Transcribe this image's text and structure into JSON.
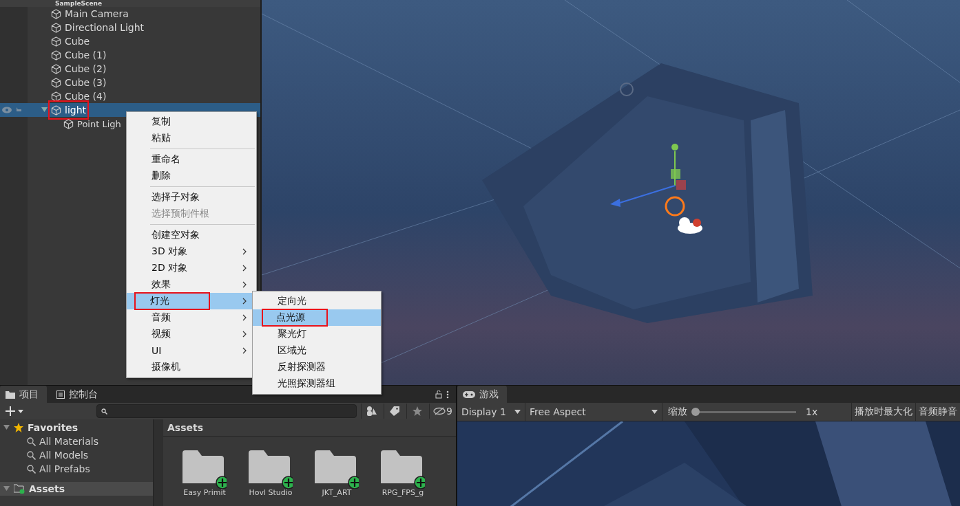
{
  "hierarchy": {
    "scene": "SampleScene",
    "items": [
      {
        "name": "Main Camera",
        "selected": false,
        "annotated": false
      },
      {
        "name": "Directional Light",
        "selected": false,
        "annotated": false
      },
      {
        "name": "Cube",
        "selected": false,
        "annotated": false
      },
      {
        "name": "Cube (1)",
        "selected": false,
        "annotated": false
      },
      {
        "name": "Cube (2)",
        "selected": false,
        "annotated": false
      },
      {
        "name": "Cube (3)",
        "selected": false,
        "annotated": false
      },
      {
        "name": "Cube (4)",
        "selected": false,
        "annotated": false
      },
      {
        "name": "light",
        "selected": true,
        "annotated": true,
        "expanded": true,
        "children": [
          {
            "name": "Point Ligh",
            "selected": false,
            "annotated": false
          }
        ]
      }
    ]
  },
  "context_menu": {
    "groups": [
      [
        {
          "label": "复制",
          "disabled": false,
          "submenu": false,
          "selected": false,
          "annotated": false
        },
        {
          "label": "粘贴",
          "disabled": false,
          "submenu": false,
          "selected": false,
          "annotated": false
        }
      ],
      [
        {
          "label": "重命名",
          "disabled": false,
          "submenu": false,
          "selected": false,
          "annotated": false
        },
        {
          "label": "删除",
          "disabled": false,
          "submenu": false,
          "selected": false,
          "annotated": false
        }
      ],
      [
        {
          "label": "选择子对象",
          "disabled": false,
          "submenu": false,
          "selected": false,
          "annotated": false
        },
        {
          "label": "选择预制件根",
          "disabled": true,
          "submenu": false,
          "selected": false,
          "annotated": false
        }
      ],
      [
        {
          "label": "创建空对象",
          "disabled": false,
          "submenu": false,
          "selected": false,
          "annotated": false
        },
        {
          "label": "3D 对象",
          "disabled": false,
          "submenu": true,
          "selected": false,
          "annotated": false
        },
        {
          "label": "2D 对象",
          "disabled": false,
          "submenu": true,
          "selected": false,
          "annotated": false
        },
        {
          "label": "效果",
          "disabled": false,
          "submenu": true,
          "selected": false,
          "annotated": false
        },
        {
          "label": "灯光",
          "disabled": false,
          "submenu": true,
          "selected": true,
          "annotated": true
        },
        {
          "label": "音频",
          "disabled": false,
          "submenu": true,
          "selected": false,
          "annotated": false
        },
        {
          "label": "视频",
          "disabled": false,
          "submenu": true,
          "selected": false,
          "annotated": false
        },
        {
          "label": "UI",
          "disabled": false,
          "submenu": true,
          "selected": false,
          "annotated": false
        },
        {
          "label": "摄像机",
          "disabled": false,
          "submenu": false,
          "selected": false,
          "annotated": false
        }
      ]
    ]
  },
  "submenu": {
    "items": [
      {
        "label": "定向光",
        "selected": false,
        "annotated": false
      },
      {
        "label": "点光源",
        "selected": true,
        "annotated": true
      },
      {
        "label": "聚光灯",
        "selected": false,
        "annotated": false
      },
      {
        "label": "区域光",
        "selected": false,
        "annotated": false
      },
      {
        "label": "反射探测器",
        "selected": false,
        "annotated": false
      },
      {
        "label": "光照探测器组",
        "selected": false,
        "annotated": false
      }
    ]
  },
  "project": {
    "tabs": [
      {
        "label": "项目",
        "selected": true,
        "kind": "folder"
      },
      {
        "label": "控制台",
        "selected": false,
        "kind": "console"
      }
    ],
    "hidden_count": "9",
    "tree": [
      {
        "label": "Favorites",
        "kind": "favorites",
        "expanded": true,
        "selected": false,
        "children": [
          {
            "label": "All Materials",
            "kind": "search"
          },
          {
            "label": "All Models",
            "kind": "search"
          },
          {
            "label": "All Prefabs",
            "kind": "search"
          }
        ]
      },
      {
        "label": "Assets",
        "kind": "assets",
        "expanded": true,
        "selected": true
      }
    ],
    "breadcrumb": "Assets",
    "folders": [
      "Easy Primit",
      "Hovl Studio",
      "JKT_ART",
      "RPG_FPS_g"
    ]
  },
  "game": {
    "tab": "游戏",
    "display": "Display 1",
    "aspect": "Free Aspect",
    "scale_label": "缩放",
    "scale": {
      "level": 0.0
    },
    "scale_reading": "1x",
    "buttons": [
      "播放时最大化",
      "音频静音"
    ]
  }
}
